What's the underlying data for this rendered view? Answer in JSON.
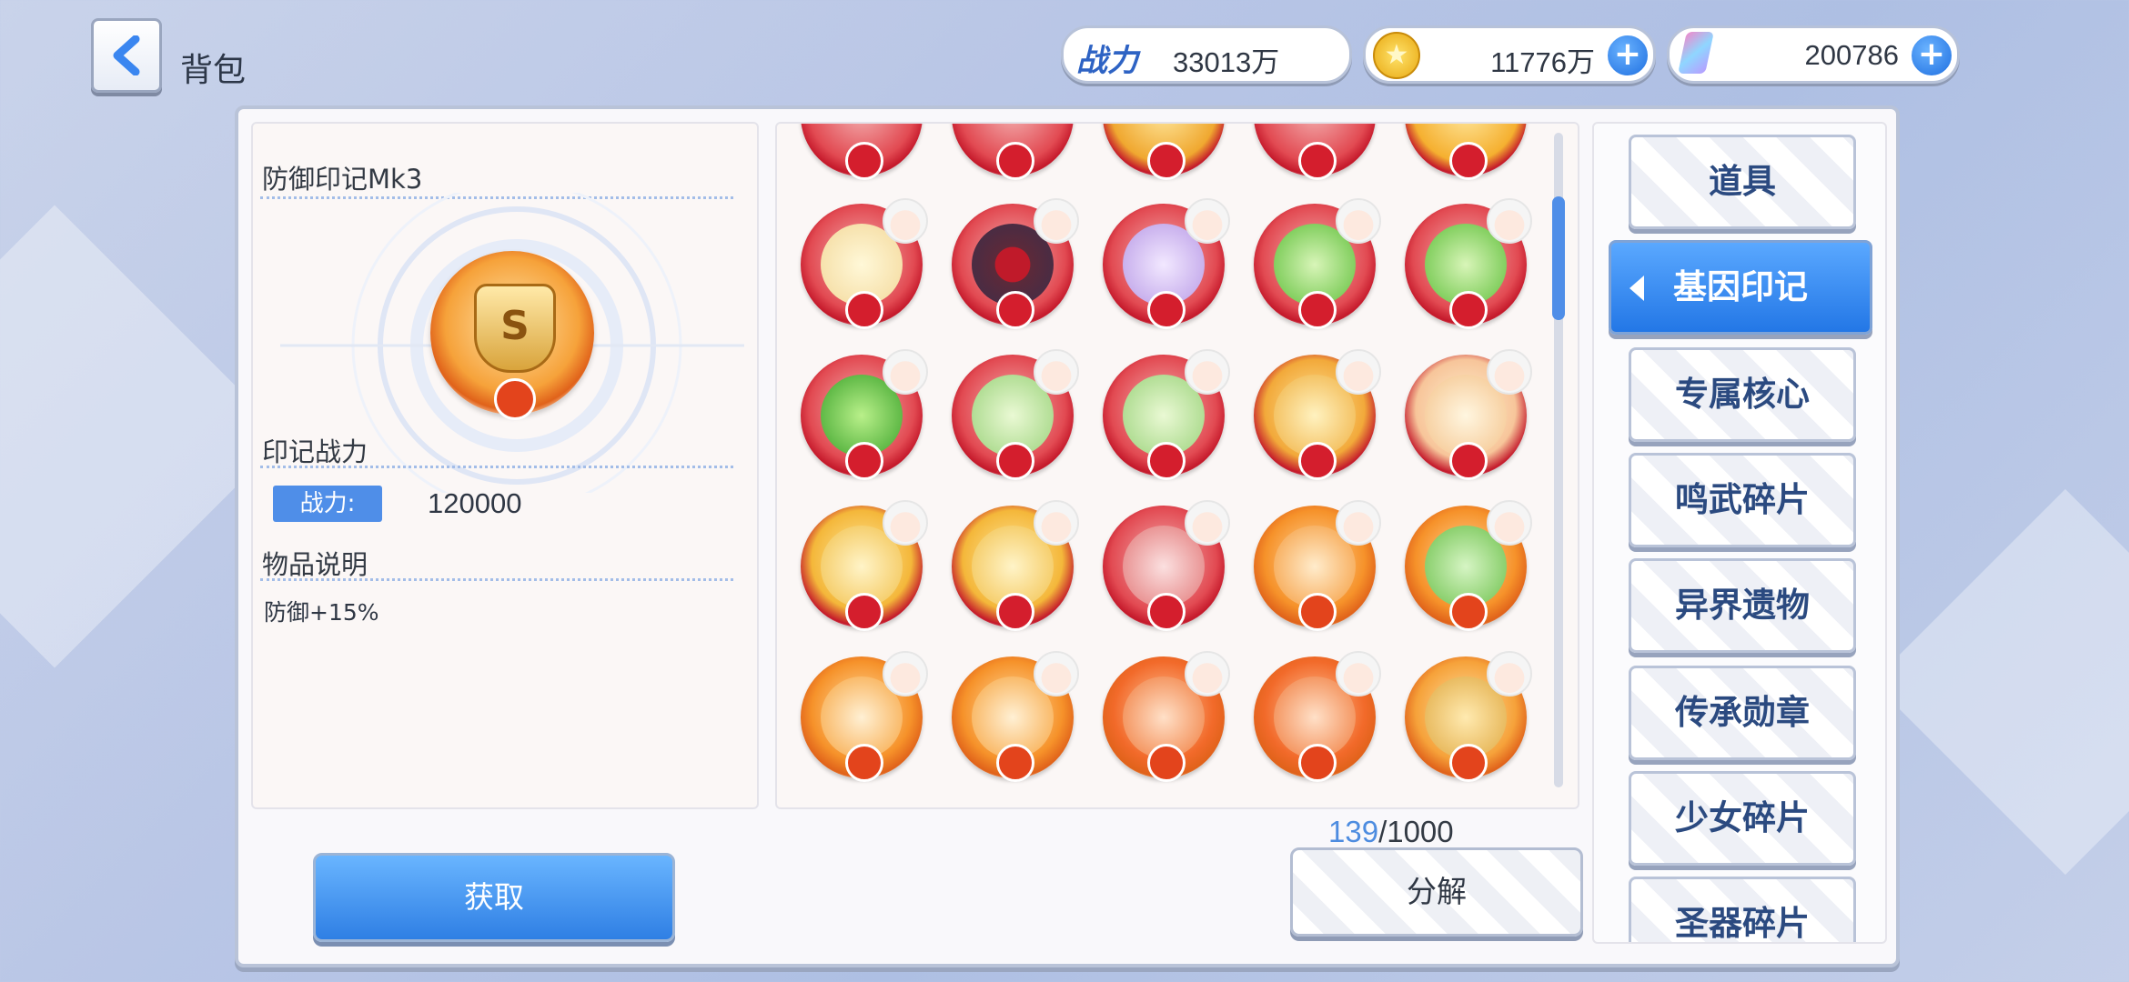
{
  "header": {
    "title": "背包"
  },
  "resources": {
    "power_label": "战力",
    "power_value": "33013万",
    "gold_value": "11776万",
    "gem_value": "200786"
  },
  "detail": {
    "item_name": "防御印记Mk3",
    "power_section": "印记战力",
    "power_label": "战力:",
    "power_value": "120000",
    "desc_section": "物品说明",
    "desc_text": "防御+15%"
  },
  "inventory": {
    "count_current": "139",
    "count_total": "/1000"
  },
  "actions": {
    "get_label": "获取",
    "split_label": "分解"
  },
  "tabs": [
    {
      "label": "道具"
    },
    {
      "label": "基因印记"
    },
    {
      "label": "专属核心"
    },
    {
      "label": "鸣武碎片"
    },
    {
      "label": "异界遗物"
    },
    {
      "label": "传承勋章"
    },
    {
      "label": "少女碎片"
    },
    {
      "label": "圣器碎片"
    }
  ],
  "colors": {
    "accent": "#2f7fe4",
    "badge_red": "#c4182a",
    "badge_orange": "#f07a20"
  }
}
